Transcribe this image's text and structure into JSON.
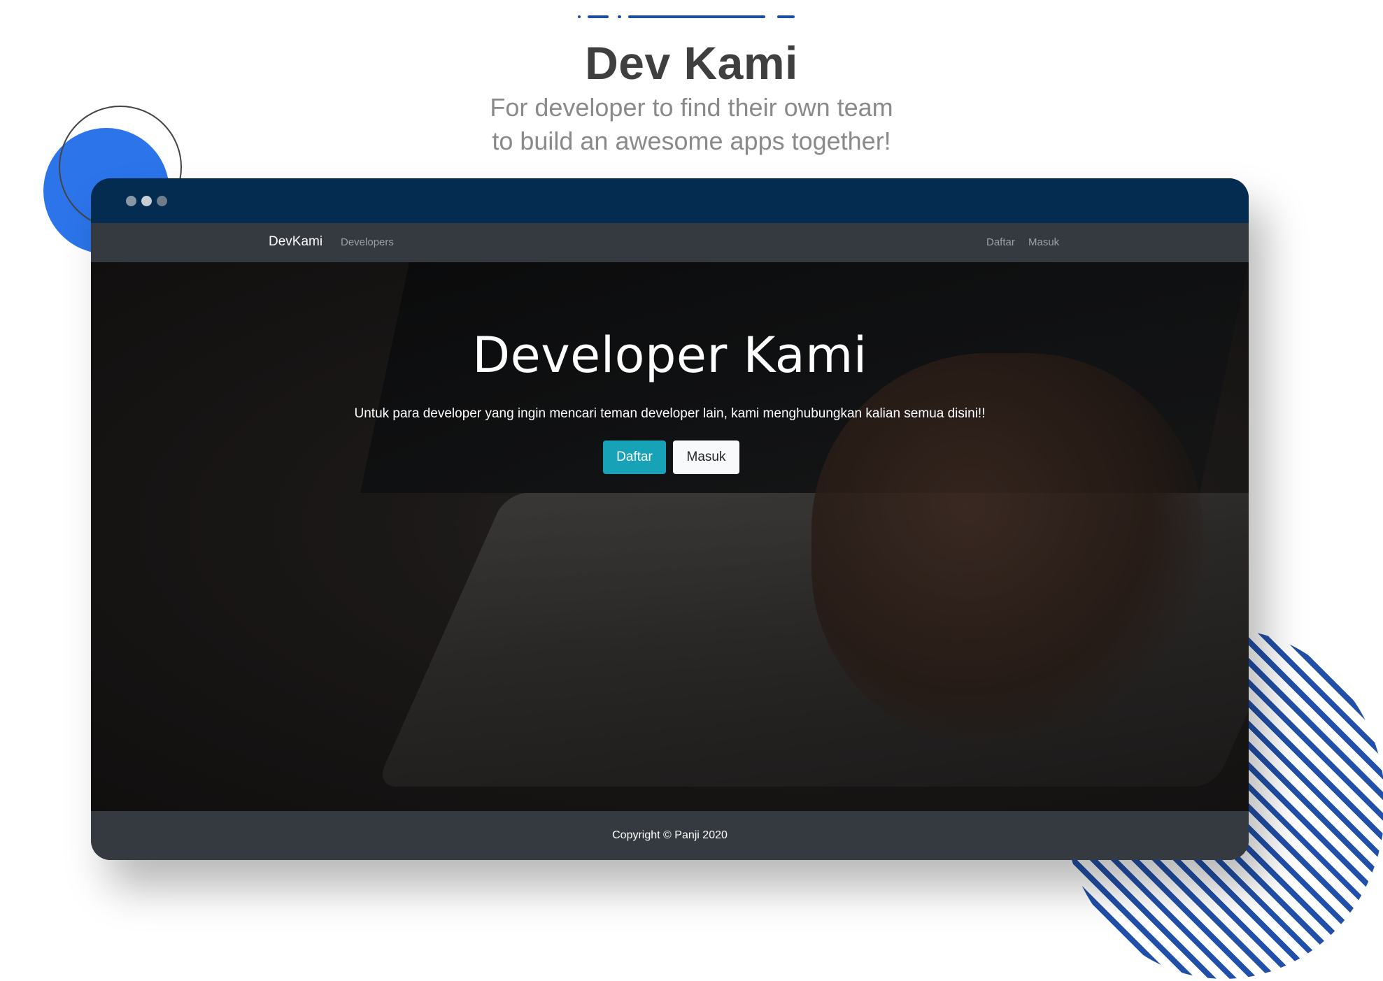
{
  "page": {
    "title": "Dev Kami",
    "tagline_line1": "For developer to find their own team",
    "tagline_line2": "to build an awesome apps together!"
  },
  "colors": {
    "accent_blue": "#2b74ea",
    "stripe_blue": "#2150aa",
    "browser_bar": "#042c51",
    "navbar_bg": "#343a40",
    "btn_primary": "#17a2b8",
    "btn_light": "#f8f9fa"
  },
  "browser": {
    "window_dots": [
      "dot",
      "dot",
      "dot"
    ]
  },
  "navbar": {
    "brand": "DevKami",
    "links_left": [
      "Developers"
    ],
    "links_right": [
      "Daftar",
      "Masuk"
    ]
  },
  "hero": {
    "title": "Developer Kami",
    "text": "Untuk para developer yang ingin mencari teman developer lain, kami menghubungkan kalian semua disini!!",
    "btn_daftar": "Daftar",
    "btn_masuk": "Masuk"
  },
  "footer": {
    "copyright": "Copyright © Panji 2020"
  }
}
